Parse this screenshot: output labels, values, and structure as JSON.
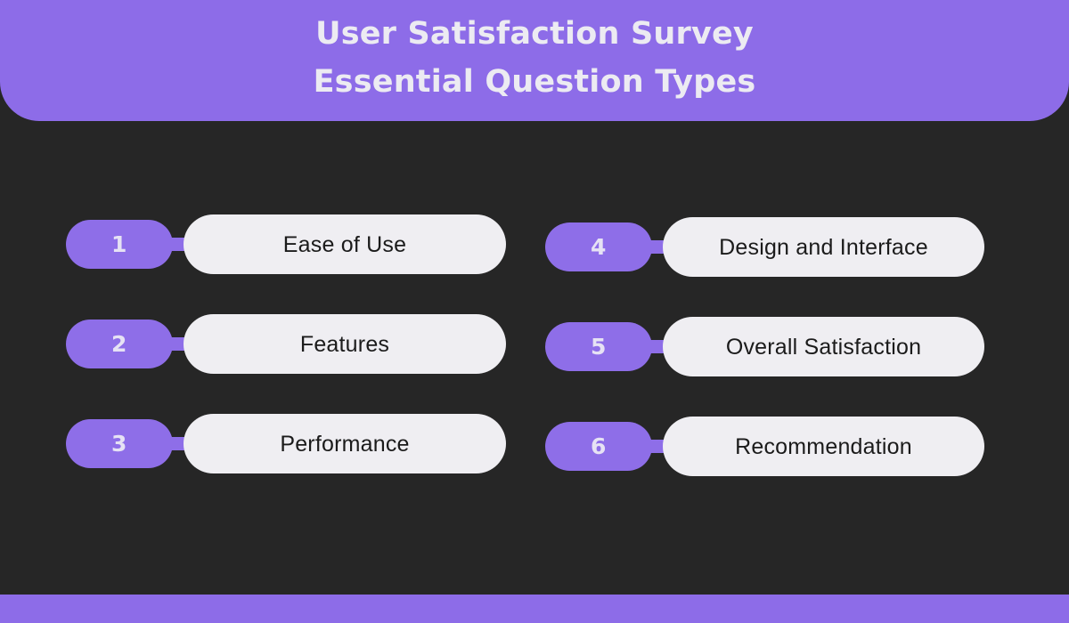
{
  "header": {
    "background_color": "#8d6ce8",
    "text_color": "#ecebf2",
    "title_line_1": "User Satisfaction Survey",
    "title_line_2": "Essential Question Types"
  },
  "canvas": {
    "background_color": "#262626"
  },
  "items": [
    {
      "number": "1",
      "label": "Ease of Use"
    },
    {
      "number": "2",
      "label": "Features"
    },
    {
      "number": "3",
      "label": "Performance"
    },
    {
      "number": "4",
      "label": "Design and Interface"
    },
    {
      "number": "5",
      "label": "Overall Satisfaction"
    },
    {
      "number": "6",
      "label": "Recommendation"
    }
  ],
  "styles": {
    "pill_purple": "#8e6ee8",
    "pill_light": "#efeef2",
    "number_text_color": "#e6e2f4",
    "label_text_color": "#1b1b1b"
  },
  "footer": {
    "background_color": "#8d6ce8"
  }
}
